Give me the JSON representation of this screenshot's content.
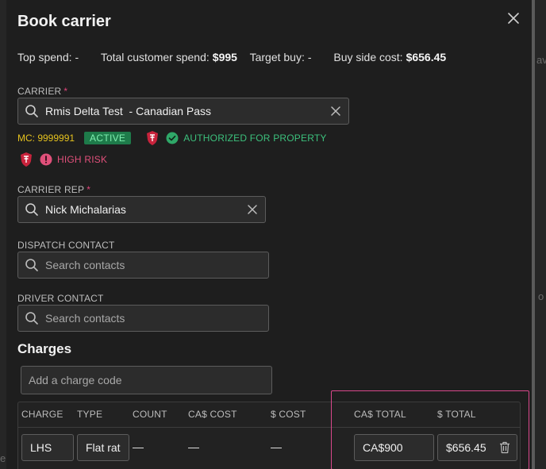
{
  "modal": {
    "title": "Book carrier",
    "close_icon": "close-icon"
  },
  "summary": {
    "top_spend_label": "Top spend:",
    "top_spend_value": "-",
    "total_customer_spend_label": "Total customer spend:",
    "total_customer_spend_value": "$995",
    "target_buy_label": "Target buy:",
    "target_buy_value": "-",
    "buy_side_cost_label": "Buy side cost:",
    "buy_side_cost_value": "$656.45"
  },
  "carrier": {
    "label": "CARRIER",
    "required_mark": "*",
    "value": "Rmis Delta Test  - Canadian Pass",
    "mc_number": "MC: 9999991",
    "status_badge": "ACTIVE",
    "authorized_text": "AUTHORIZED FOR PROPERTY",
    "risk_text": "HIGH RISK"
  },
  "carrier_rep": {
    "label": "CARRIER REP",
    "required_mark": "*",
    "value": "Nick Michalarias"
  },
  "dispatch_contact": {
    "label": "DISPATCH CONTACT",
    "placeholder": "Search contacts"
  },
  "driver_contact": {
    "label": "DRIVER CONTACT",
    "placeholder": "Search contacts"
  },
  "charges": {
    "title": "Charges",
    "add_placeholder": "Add a charge code",
    "columns": [
      "CHARGE",
      "TYPE",
      "COUNT",
      "CA$ COST",
      "$ COST",
      "CA$ TOTAL",
      "$ TOTAL"
    ],
    "rows": [
      {
        "charge": "LHS",
        "type": "Flat rat",
        "count": "—",
        "ca_cost": "—",
        "usd_cost": "—",
        "ca_total": "CA$900",
        "usd_total": "$656.45"
      }
    ]
  },
  "background": {
    "frag_right_1": "ava",
    "frag_right_2": "o",
    "frag_left": "e"
  },
  "colors": {
    "accent_required": "#e0457b",
    "active_badge": "#1e7b4a",
    "authorized": "#3cc07c",
    "high_risk": "#e0507a",
    "mc": "#e5c21e",
    "highlight": "#d9488c"
  }
}
